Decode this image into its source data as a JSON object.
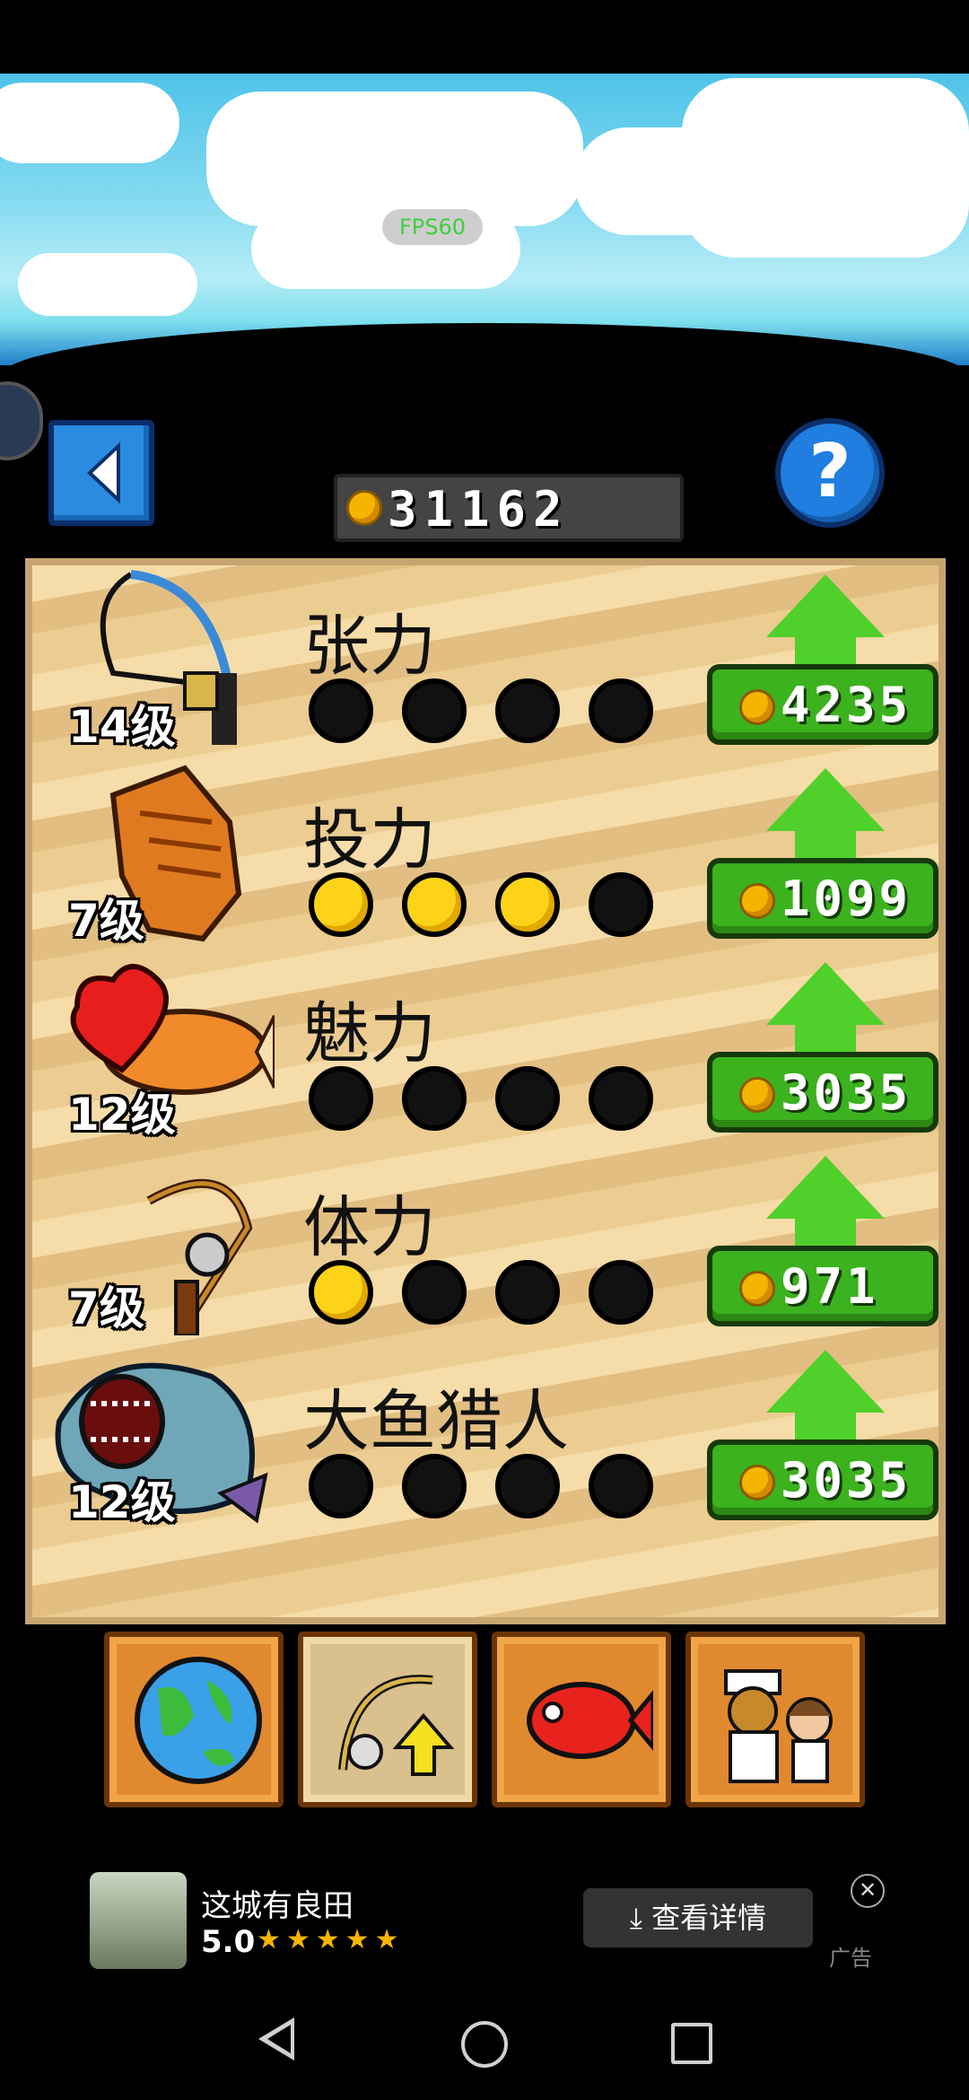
{
  "hud": {
    "fps": "FPS60",
    "coins": "31162"
  },
  "colors": {
    "upgrade_green": "#3cb21e",
    "coin_gold": "#f5b400",
    "dot_filled": "#fcd318",
    "panel_sand": "#e9c98d"
  },
  "upgrades": [
    {
      "name": "张力",
      "level": "14级",
      "icon": "fishing-line-icon",
      "progress": 0,
      "max": 4,
      "price": "4235"
    },
    {
      "name": "投力",
      "level": "7级",
      "icon": "glove-icon",
      "progress": 3,
      "max": 4,
      "price": "1099"
    },
    {
      "name": "魅力",
      "level": "12级",
      "icon": "heart-fish-icon",
      "progress": 0,
      "max": 4,
      "price": "3035"
    },
    {
      "name": "体力",
      "level": "7级",
      "icon": "fishing-rod-icon",
      "progress": 1,
      "max": 4,
      "price": "971"
    },
    {
      "name": "大鱼猎人",
      "level": "12级",
      "icon": "big-fish-monster-icon",
      "progress": 0,
      "max": 4,
      "price": "3035"
    }
  ],
  "tabs": [
    {
      "name": "world",
      "icon": "globe-icon",
      "active": false
    },
    {
      "name": "upgrade",
      "icon": "rod-upgrade-icon",
      "active": true
    },
    {
      "name": "fish",
      "icon": "red-fish-icon",
      "active": false
    },
    {
      "name": "shop",
      "icon": "chef-characters-icon",
      "active": false
    }
  ],
  "ad": {
    "title": "这城有良田",
    "rating": "5.0",
    "stars": "★★★★★",
    "button": "查看详情",
    "tag": "广告",
    "close": "✕"
  }
}
